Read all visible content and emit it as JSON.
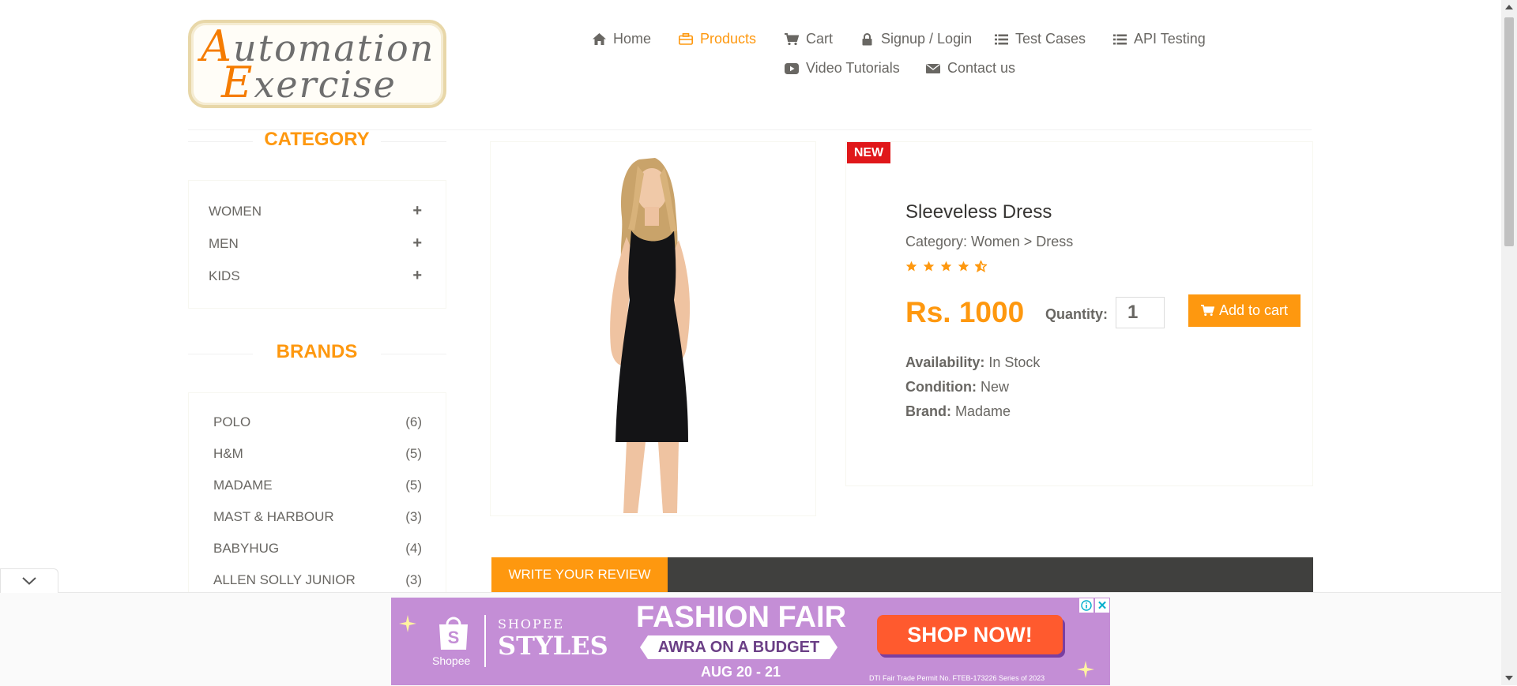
{
  "logo": {
    "line1_cap": "A",
    "line1_rest": "utomation",
    "line2_cap": "E",
    "line2_rest": "xercise"
  },
  "nav": {
    "items": [
      {
        "label": "Home",
        "icon": "home-icon"
      },
      {
        "label": "Products",
        "icon": "briefcase-icon",
        "active": true
      },
      {
        "label": "Cart",
        "icon": "cart-icon"
      },
      {
        "label": "Signup / Login",
        "icon": "lock-icon"
      },
      {
        "label": "Test Cases",
        "icon": "list-icon"
      },
      {
        "label": "API Testing",
        "icon": "list-icon"
      },
      {
        "label": "Video Tutorials",
        "icon": "youtube-play-icon"
      },
      {
        "label": "Contact us",
        "icon": "envelope-icon"
      }
    ]
  },
  "sidebar": {
    "category_title": "CATEGORY",
    "categories": [
      {
        "label": "WOMEN",
        "toggle": "+"
      },
      {
        "label": "MEN",
        "toggle": "+"
      },
      {
        "label": "KIDS",
        "toggle": "+"
      }
    ],
    "brands_title": "BRANDS",
    "brands": [
      {
        "label": "POLO",
        "count": "(6)"
      },
      {
        "label": "H&M",
        "count": "(5)"
      },
      {
        "label": "MADAME",
        "count": "(5)"
      },
      {
        "label": "MAST & HARBOUR",
        "count": "(3)"
      },
      {
        "label": "BABYHUG",
        "count": "(4)"
      },
      {
        "label": "ALLEN SOLLY JUNIOR",
        "count": "(3)"
      }
    ]
  },
  "product": {
    "badge": "NEW",
    "name": "Sleeveless Dress",
    "category": "Category: Women > Dress",
    "rating": 4.5,
    "price": "Rs. 1000",
    "quantity_label": "Quantity:",
    "quantity_value": "1",
    "add_to_cart": "Add to cart",
    "availability_label": "Availability:",
    "availability": "In Stock",
    "condition_label": "Condition:",
    "condition": "New",
    "brand_label": "Brand:",
    "brand": "Madame"
  },
  "review": {
    "tab_label": "WRITE YOUR REVIEW"
  },
  "ad": {
    "shopee_label": "Shopee",
    "shopee_title_top": "SHOPEE",
    "shopee_title_bottom": "STYLES",
    "headline": "FASHION FAIR",
    "subhead": "AWRA ON A BUDGET",
    "dates": "AUG 20 - 21",
    "cta": "SHOP NOW!",
    "permit": "DTI Fair Trade Permit No. FTEB-173226 Series of 2023",
    "close_glyph": "✕"
  },
  "colors": {
    "accent": "#fe980f",
    "badge": "#e0171a",
    "review_bar": "#40403e",
    "ad_bg": "#c48ed6"
  }
}
